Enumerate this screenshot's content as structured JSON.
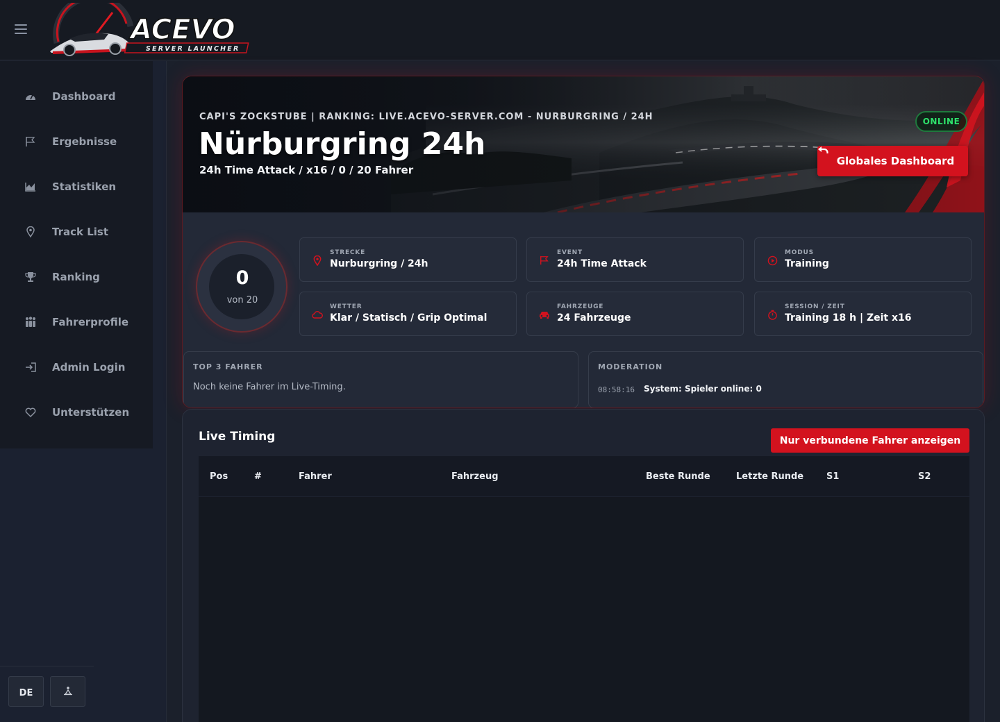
{
  "app": {
    "logo_text": "ACEVO",
    "logo_tagline": "SERVER LAUNCHER"
  },
  "sidebar": {
    "items": [
      {
        "label": "Dashboard",
        "icon": "gauge-icon"
      },
      {
        "label": "Ergebnisse",
        "icon": "flag-icon"
      },
      {
        "label": "Statistiken",
        "icon": "area-chart-icon"
      },
      {
        "label": "Track List",
        "icon": "map-pin-icon"
      },
      {
        "label": "Ranking",
        "icon": "trophy-icon"
      },
      {
        "label": "Fahrerprofile",
        "icon": "users-icon"
      },
      {
        "label": "Admin Login",
        "icon": "sign-in-icon"
      },
      {
        "label": "Unterstützen",
        "icon": "heart-icon"
      }
    ],
    "language": "DE"
  },
  "hero": {
    "subtitle": "CAPI'S ZOCKSTUBE | RANKING: LIVE.ACEVO-SERVER.COM - NURBURGRING / 24H",
    "title": "Nürburgring 24h",
    "line": "24h Time Attack / x16 / 0 / 20 Fahrer",
    "status": "ONLINE",
    "dashboard_button": "Globales Dashboard"
  },
  "gauge": {
    "value": "0",
    "sub": "von 20",
    "filled_fraction": 0
  },
  "tiles": [
    {
      "label": "STRECKE",
      "value": "Nurburgring / 24h",
      "icon": "map-pin-icon"
    },
    {
      "label": "EVENT",
      "value": "24h Time Attack",
      "icon": "flag-icon"
    },
    {
      "label": "MODUS",
      "value": "Training",
      "icon": "play-circle-icon"
    },
    {
      "label": "WETTER",
      "value": "Klar / Statisch / Grip Optimal",
      "icon": "cloud-icon"
    },
    {
      "label": "FAHRZEUGE",
      "value": "24 Fahrzeuge",
      "icon": "car-icon"
    },
    {
      "label": "SESSION / ZEIT",
      "value": "Training 18 h | Zeit x16",
      "icon": "stopwatch-icon"
    }
  ],
  "top3": {
    "title": "TOP 3 FAHRER",
    "empty_text": "Noch keine Fahrer im Live-Timing."
  },
  "moderation": {
    "title": "MODERATION",
    "log": [
      {
        "time": "08:58:16",
        "text": "System: Spieler online: 0"
      }
    ]
  },
  "live_timing": {
    "title": "Live Timing",
    "filter_button": "Nur verbundene Fahrer anzeigen",
    "columns": [
      "Pos",
      "#",
      "Fahrer",
      "Fahrzeug",
      "Beste Runde",
      "Letzte Runde",
      "S1",
      "S2"
    ],
    "rows": []
  },
  "colors": {
    "accent": "#d3121e",
    "online": "#2ee06a",
    "background": "#1b202b"
  }
}
